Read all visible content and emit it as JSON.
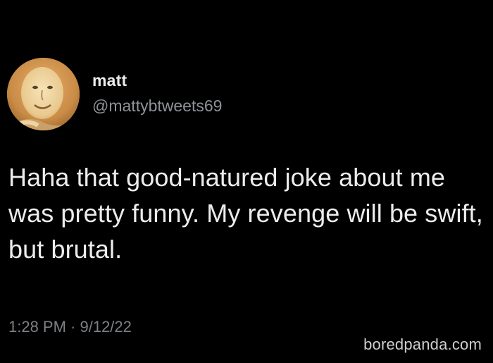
{
  "tweet": {
    "display_name": "matt",
    "handle": "@mattybtweets69",
    "text": "Haha that good-natured joke about me was pretty funny. My revenge will be swift, but brutal.",
    "timestamp": "1:28 PM · 9/12/22",
    "avatar_icon": "cartoon-face-avatar"
  },
  "watermark": {
    "text": "boredpanda.com"
  },
  "colors": {
    "background": "#000000",
    "primary_text": "#ececec",
    "secondary_text": "#8e9296"
  }
}
